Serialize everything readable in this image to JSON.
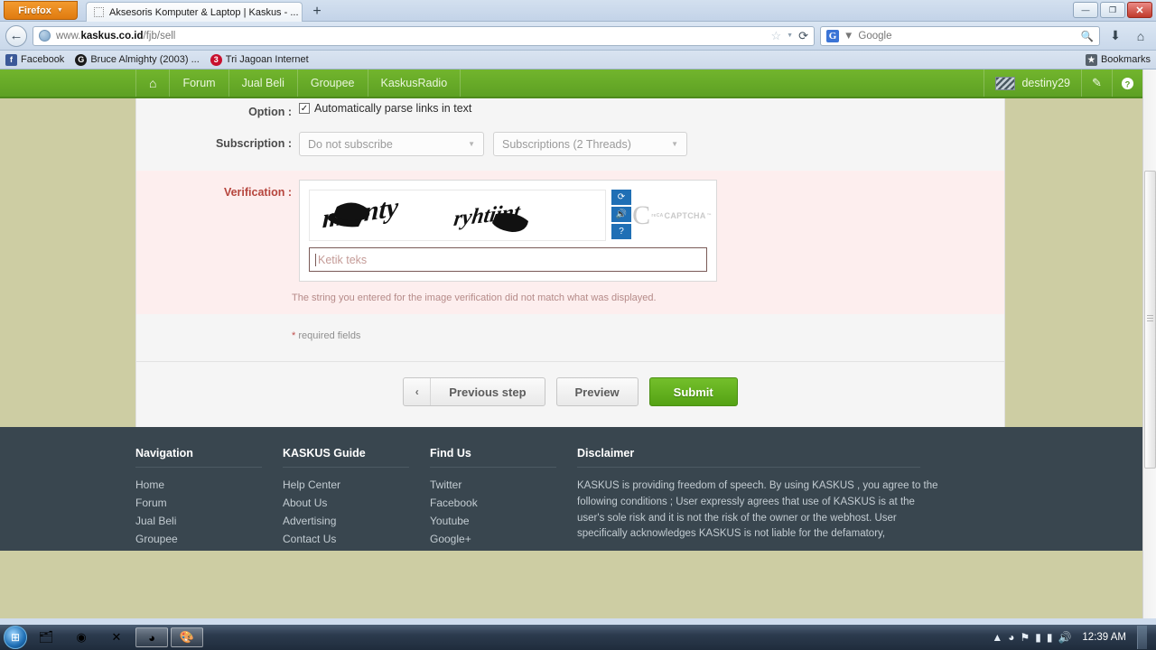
{
  "browser": {
    "firefox_button": "Firefox",
    "tab_title": "Aksesoris Komputer & Laptop | Kaskus - ...",
    "newtab_label": "+",
    "window_controls": {
      "minimize": "—",
      "restore": "❐",
      "close": "✕"
    },
    "url_prefix": "www.",
    "url_domain": "kaskus.co.id",
    "url_path": "/fjb/sell",
    "search_placeholder": "Google",
    "search_engine_letter": "G",
    "icons": {
      "back": "back-arrow-icon",
      "globe": "site-identity-icon",
      "star": "bookmark-star-icon",
      "reload": "reload-icon",
      "search": "search-icon",
      "downloads": "downloads-icon",
      "home": "home-icon"
    },
    "bookmarks": [
      {
        "label": "Facebook",
        "icon_letter": "f",
        "icon_color": "#3b5998"
      },
      {
        "label": "Bruce Almighty (2003) ...",
        "icon_letter": "G",
        "icon_color": "#1a1a1a"
      },
      {
        "label": "Tri Jagoan Internet",
        "icon_letter": "3",
        "icon_color": "#c8102e"
      }
    ],
    "bookmarks_right_label": "Bookmarks"
  },
  "sitenav": {
    "home_icon": "home-icon",
    "items": [
      "Forum",
      "Jual Beli",
      "Groupee",
      "KaskusRadio"
    ],
    "username": "destiny29",
    "edit_icon": "pencil-icon",
    "help_icon": "help-icon"
  },
  "form": {
    "option": {
      "label": "Option",
      "colon": ":",
      "checkbox_checked": "✓",
      "checkbox_label": "Automatically parse links in text"
    },
    "subscription": {
      "label": "Subscription",
      "colon": ":",
      "select_one": "Do not subscribe",
      "select_two": "Subscriptions (2 Threads)",
      "arrow": "▼"
    },
    "verification": {
      "label": "Verification",
      "colon": ":",
      "captcha_word_one": "mrrnty",
      "captcha_word_two": "ryhtiint",
      "refresh_icon": "refresh-icon",
      "audio_icon": "audio-icon",
      "help_icon": "help-icon",
      "logo_text": "CAPTCHA",
      "logo_prefix": "reCA",
      "logo_tm": "™",
      "input_value": "Ketik teks",
      "error_message": "The string you entered for the image verification did not match what was displayed."
    },
    "required_note_star": "*",
    "required_note": " required fields"
  },
  "buttons": {
    "previous_chevron": "‹",
    "previous": "Previous step",
    "preview": "Preview",
    "submit": "Submit",
    "submit_color": "#5da023"
  },
  "footer": {
    "columns": [
      {
        "title": "Navigation",
        "links": [
          "Home",
          "Forum",
          "Jual Beli",
          "Groupee"
        ]
      },
      {
        "title": "KASKUS Guide",
        "links": [
          "Help Center",
          "About Us",
          "Advertising",
          "Contact Us"
        ]
      },
      {
        "title": "Find Us",
        "links": [
          "Twitter",
          "Facebook",
          "Youtube",
          "Google+"
        ]
      }
    ],
    "disclaimer_title": "Disclaimer",
    "disclaimer_text": "KASKUS is providing freedom of speech. By using KASKUS , you agree to the following conditions ; User expressly agrees that use of KASKUS is at the user's sole risk and it is not the risk of the owner or the webhost. User specifically acknowledges KASKUS is not liable for the defamatory,"
  },
  "taskbar": {
    "start_icon": "windows-start-icon",
    "tasks": [
      {
        "name": "explorer-icon",
        "glyph": "🗂",
        "active": false
      },
      {
        "name": "media-player-icon",
        "glyph": "◉",
        "active": false
      },
      {
        "name": "messenger-icon",
        "glyph": "✕",
        "active": false
      },
      {
        "name": "firefox-icon",
        "glyph": "◕",
        "active": true
      },
      {
        "name": "paint-icon",
        "glyph": "🎨",
        "active": true
      }
    ],
    "tray": [
      {
        "name": "tray-expand-icon",
        "glyph": "▲"
      },
      {
        "name": "safely-remove-icon",
        "glyph": "◕"
      },
      {
        "name": "action-center-icon",
        "glyph": "⚑"
      },
      {
        "name": "battery-icon",
        "glyph": "▮"
      },
      {
        "name": "network-icon",
        "glyph": "▮"
      },
      {
        "name": "volume-icon",
        "glyph": "🔊"
      }
    ],
    "clock": "12:39 AM"
  }
}
